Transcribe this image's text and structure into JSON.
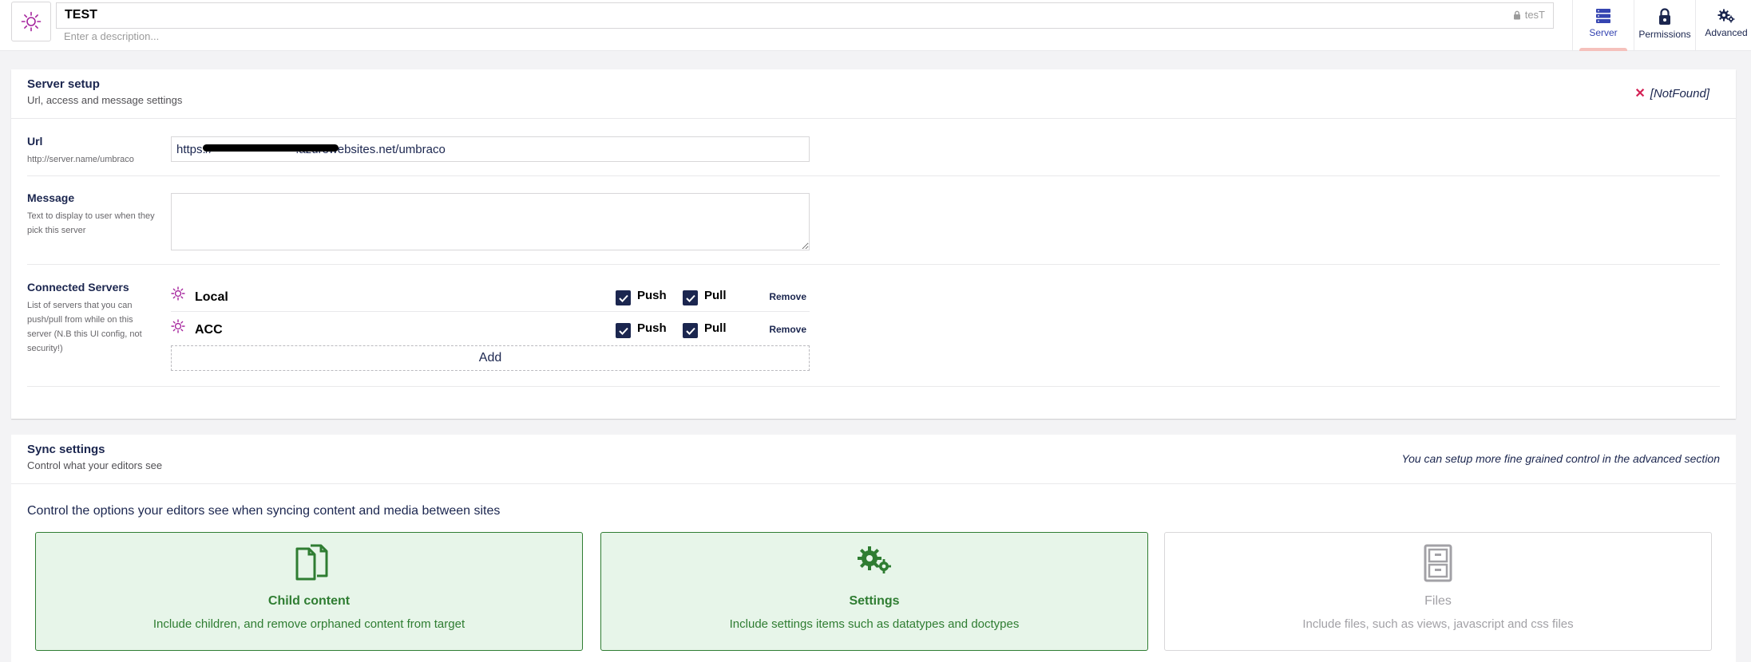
{
  "header": {
    "name": "TEST",
    "alias": "tesT",
    "description_placeholder": "Enter a description...",
    "nav": [
      {
        "label": "Server",
        "icon": "server-icon",
        "active": true
      },
      {
        "label": "Permissions",
        "icon": "lock-icon",
        "active": false
      },
      {
        "label": "Advanced",
        "icon": "settings-icon",
        "active": false
      }
    ]
  },
  "server_setup": {
    "title": "Server setup",
    "subtitle": "Url, access and message settings",
    "status": "[NotFound]",
    "url": {
      "label": "Url",
      "hint": "http://server.name/umbraco",
      "value": "https://                         .azurewebsites.net/umbraco"
    },
    "message": {
      "label": "Message",
      "hint": "Text to display to user when they pick this server",
      "value": ""
    },
    "connected": {
      "label": "Connected Servers",
      "hint": "List of servers that you can push/pull from while on this server (N.B this UI config, not security!)",
      "servers": [
        {
          "name": "Local",
          "push": "Push",
          "pull": "Pull",
          "remove": "Remove"
        },
        {
          "name": "ACC",
          "push": "Push",
          "pull": "Pull",
          "remove": "Remove"
        }
      ],
      "add_label": "Add"
    }
  },
  "sync_settings": {
    "title": "Sync settings",
    "subtitle": "Control what your editors see",
    "hint": "You can setup more fine grained control in the advanced section",
    "intro": "Control the options your editors see when syncing content and media between sites",
    "cards": [
      {
        "title": "Child content",
        "desc": "Include children, and remove orphaned content from target",
        "selected": true,
        "icon": "documents-icon"
      },
      {
        "title": "Settings",
        "desc": "Include settings items such as datatypes and doctypes",
        "selected": true,
        "icon": "settings-icon"
      },
      {
        "title": "Files",
        "desc": "Include files, such as views, javascript and css files",
        "selected": false,
        "icon": "filing-cabinet-icon"
      }
    ]
  },
  "colors": {
    "accent": "#1b264f",
    "active_nav": "#3544b1",
    "selected_card_bg": "#e7f5e9",
    "selected_card_fg": "#2f7d32",
    "error": "#d42054",
    "sun_icon": "#a5249d"
  }
}
